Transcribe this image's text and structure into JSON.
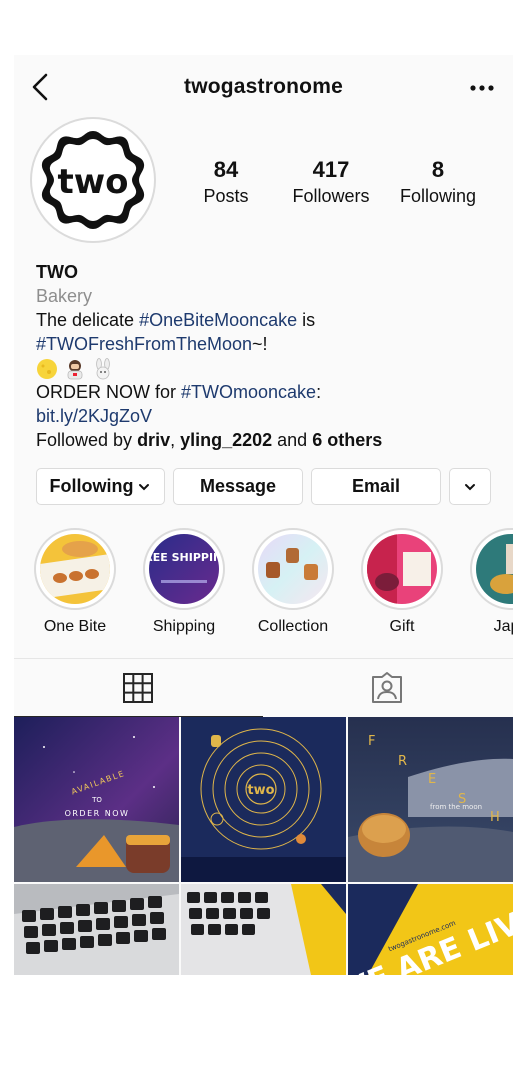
{
  "header": {
    "username": "twogastronome"
  },
  "profile": {
    "avatar_text": "two",
    "stats": [
      {
        "value": "84",
        "label": "Posts"
      },
      {
        "value": "417",
        "label": "Followers"
      },
      {
        "value": "8",
        "label": "Following"
      }
    ]
  },
  "bio": {
    "name": "TWO",
    "category": "Bakery",
    "line1_a": "The delicate ",
    "line1_tag": "#OneBiteMooncake",
    "line1_b": " is",
    "line2_tag": "#TWOFreshFromTheMoon",
    "line2_b": "~!",
    "order_a": "ORDER NOW for ",
    "order_tag": "#TWOmooncake",
    "order_b": ":",
    "link": "bit.ly/2KJgZoV",
    "followed_prefix": "Followed by ",
    "followed_user1": "driv",
    "followed_sep": ", ",
    "followed_user2": "yling_2202",
    "followed_and": " and ",
    "followed_others": "6 others"
  },
  "buttons": {
    "following": "Following",
    "message": "Message",
    "email": "Email"
  },
  "highlights": [
    {
      "label": "One Bite"
    },
    {
      "label": "Shipping",
      "badge": "FREE SHIPPING"
    },
    {
      "label": "Collection"
    },
    {
      "label": "Gift"
    },
    {
      "label": "Japa"
    }
  ],
  "posts": {
    "p1_line1": "AVAILABLE",
    "p1_line2": "TO",
    "p1_line3": "ORDER NOW",
    "p2_logo": "two",
    "p3_letters": [
      "F",
      "R",
      "E",
      "S",
      "H"
    ],
    "p3_sub": "from the moon",
    "p6_text": "WE ARE LIVE!",
    "p6_url": "twogastronome.com"
  },
  "colors": {
    "link_blue": "#1e3a6e",
    "secondary_gray": "#8e8e8e",
    "border": "#dbdbdb",
    "gold": "#e0b64a",
    "navy": "#1b2a5c",
    "yellow": "#f2c617"
  }
}
